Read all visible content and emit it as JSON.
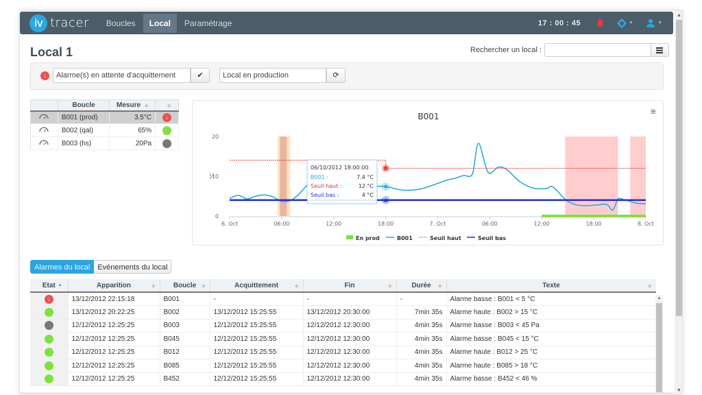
{
  "app": {
    "logo_iv": "iv",
    "logo_tracer": "tracer",
    "nav": [
      {
        "label": "Boucles",
        "active": false
      },
      {
        "label": "Local",
        "active": true
      },
      {
        "label": "Paramétrage",
        "active": false
      }
    ],
    "clock": "17 : 00 : 45",
    "icons": {
      "bell": "bell-icon",
      "settings": "gear-icon",
      "user": "user-icon"
    },
    "colors": {
      "navbar": "#4b5d68",
      "accent": "#2aa5e0",
      "alarm": "#ee5050",
      "ok": "#7ee23d",
      "off": "#777777"
    }
  },
  "page": {
    "title": "Local 1",
    "search_label": "Rechercher un local :",
    "search_value": "",
    "status": {
      "alarm_field": "Alarme(s) en attente d'acquittement",
      "alarm_button": "✔",
      "production_field": "Local en production",
      "production_button": "⟳"
    }
  },
  "boucles": {
    "headers": [
      "",
      "Boucle",
      "Mesure",
      ""
    ],
    "rows": [
      {
        "name": "B001 (prod)",
        "mesure": "3.5°C",
        "state": "alarm",
        "selected": true
      },
      {
        "name": "B002 (qal)",
        "mesure": "65%",
        "state": "ok",
        "selected": false
      },
      {
        "name": "B003 (hs)",
        "mesure": "20Pa",
        "state": "off",
        "selected": false
      }
    ]
  },
  "chart_data": {
    "type": "line",
    "title": "B001",
    "ylabel": "°C",
    "xlabel": "",
    "ylim": [
      0,
      20
    ],
    "yticks": [
      0,
      10,
      20
    ],
    "x_unit": "hours since 6 Oct 00:00",
    "xlim": [
      0,
      48
    ],
    "xticks": [
      {
        "x": 0,
        "label": "6. Oct"
      },
      {
        "x": 6,
        "label": "06:00"
      },
      {
        "x": 12,
        "label": "12:00"
      },
      {
        "x": 18,
        "label": "18:00"
      },
      {
        "x": 24,
        "label": "7. Oct"
      },
      {
        "x": 30,
        "label": "06:00"
      },
      {
        "x": 36,
        "label": "12:00"
      },
      {
        "x": 42,
        "label": "18:00"
      },
      {
        "x": 48,
        "label": "8. Oct"
      }
    ],
    "series": [
      {
        "name": "B001",
        "color": "#29a9e1",
        "x": [
          0,
          1,
          2,
          3,
          4,
          5,
          6,
          7,
          8,
          9,
          10,
          11,
          12,
          14,
          16,
          18,
          20,
          22,
          24,
          25,
          26,
          27,
          28,
          28.7,
          29.8,
          31,
          32,
          33.5,
          35,
          36.5,
          37.3,
          38.8,
          40,
          41.2,
          42.5,
          43.5,
          44.2,
          44.8,
          45.5,
          46,
          47,
          48
        ],
        "values": [
          4.4,
          5.2,
          4.3,
          5,
          5.3,
          4.8,
          3.7,
          3.9,
          5.5,
          7.8,
          8,
          7.8,
          7.6,
          7.8,
          7.5,
          7.4,
          6.5,
          6.8,
          8.2,
          9,
          9.5,
          10.2,
          10.6,
          18.3,
          11,
          12.3,
          11.6,
          8.6,
          7,
          6.9,
          7.3,
          4,
          2.8,
          2.6,
          2.8,
          2.9,
          1.5,
          4.3,
          4.1,
          3.8,
          3.2,
          3.1
        ]
      },
      {
        "name": "Seuil haut",
        "color": "#ee4444",
        "style": "dotted",
        "x": [
          0,
          18,
          18,
          48
        ],
        "values": [
          14,
          14,
          12,
          12
        ]
      },
      {
        "name": "Seuil bas",
        "color": "#1f2fe0",
        "style": "solid",
        "x": [
          0,
          48
        ],
        "values": [
          4,
          4
        ]
      },
      {
        "name": "En prod",
        "color": "#7ee23d",
        "type": "range",
        "ranges": [
          [
            36,
            48
          ]
        ]
      }
    ],
    "bands": [
      {
        "from": 5.5,
        "to": 7,
        "color": "#fde2c2",
        "label": "warning"
      },
      {
        "from": 5.8,
        "to": 6.6,
        "color": "#eab59d",
        "label": "warning-core"
      },
      {
        "from": 38.7,
        "to": 44.8,
        "color": "#ffcdcd",
        "label": "alarm"
      },
      {
        "from": 46.2,
        "to": 48,
        "color": "#ffcdcd",
        "label": "alarm"
      }
    ],
    "tooltip": {
      "x": 18,
      "date": "06/10/2012 18:00:00",
      "rows": [
        {
          "label": "B001 :",
          "value": "7.4 °C",
          "color": "#29a9e1"
        },
        {
          "label": "Seuil haut :",
          "value": "12 °C",
          "color": "#ee3333"
        },
        {
          "label": "Seuil bas :",
          "value": "4 °C",
          "color": "#1f2fe0"
        }
      ]
    },
    "legend": [
      {
        "label": "En prod",
        "color": "#7ee23d",
        "kind": "box"
      },
      {
        "label": "B001",
        "color": "#29a9e1",
        "kind": "line"
      },
      {
        "label": "Seuil haut",
        "color": "#ee4444",
        "kind": "dotted"
      },
      {
        "label": "Seuil bas",
        "color": "#1f2fe0",
        "kind": "line"
      }
    ],
    "legend_position": "bottom-center",
    "grid": false
  },
  "tabs": [
    {
      "label": "Alarmes du local",
      "active": true
    },
    {
      "label": "Evénements du local",
      "active": false
    }
  ],
  "alarms": {
    "headers": [
      "Etat",
      "Apparition",
      "Boucle",
      "Acquittement",
      "Fin",
      "Durée",
      "Texte"
    ],
    "rows": [
      {
        "state": "alarm",
        "apparition": "13/12/2012 22:15:18",
        "boucle": "B001",
        "acquittement": "-",
        "fin": "-",
        "duree": "-",
        "texte": "Alarme basse : B001 < 5 °C"
      },
      {
        "state": "ok",
        "apparition": "13/12/2012 20:22:25",
        "boucle": "B002",
        "acquittement": "13/12/2012 15:25:55",
        "fin": "13/12/2012 20:30:00",
        "duree": "7min 35s",
        "texte": "Alarme haute : B002 > 15 °C"
      },
      {
        "state": "off",
        "apparition": "12/12/2012 12:25:25",
        "boucle": "B003",
        "acquittement": "12/12/2012 15:25:55",
        "fin": "12/12/2012 12:30:00",
        "duree": "4min 35s",
        "texte": "Alarme basse : B003 < 45 Pa"
      },
      {
        "state": "ok",
        "apparition": "12/12/2012 12:25:25",
        "boucle": "B045",
        "acquittement": "12/12/2012 15:25:55",
        "fin": "12/12/2012 12:30:00",
        "duree": "4min 35s",
        "texte": "Alarme basse : B045 < 15 °C"
      },
      {
        "state": "ok",
        "apparition": "12/12/2012 12:25:25",
        "boucle": "B012",
        "acquittement": "12/12/2012 15:25:55",
        "fin": "12/12/2012 12:30:00",
        "duree": "4min 35s",
        "texte": "Alarme haute : B012 > 25 °C"
      },
      {
        "state": "ok",
        "apparition": "12/12/2012 12:25:25",
        "boucle": "B085",
        "acquittement": "12/12/2012 15:25:55",
        "fin": "12/12/2012 12:30:00",
        "duree": "4min 35s",
        "texte": "Alarme haute : B085 > 18 °C"
      },
      {
        "state": "ok",
        "apparition": "12/12/2012 12:25:25",
        "boucle": "B452",
        "acquittement": "12/12/2012 15:25:55",
        "fin": "12/12/2012 12:30:00",
        "duree": "4min 35s",
        "texte": "Alarme basse : B452 < 46 %"
      }
    ]
  }
}
